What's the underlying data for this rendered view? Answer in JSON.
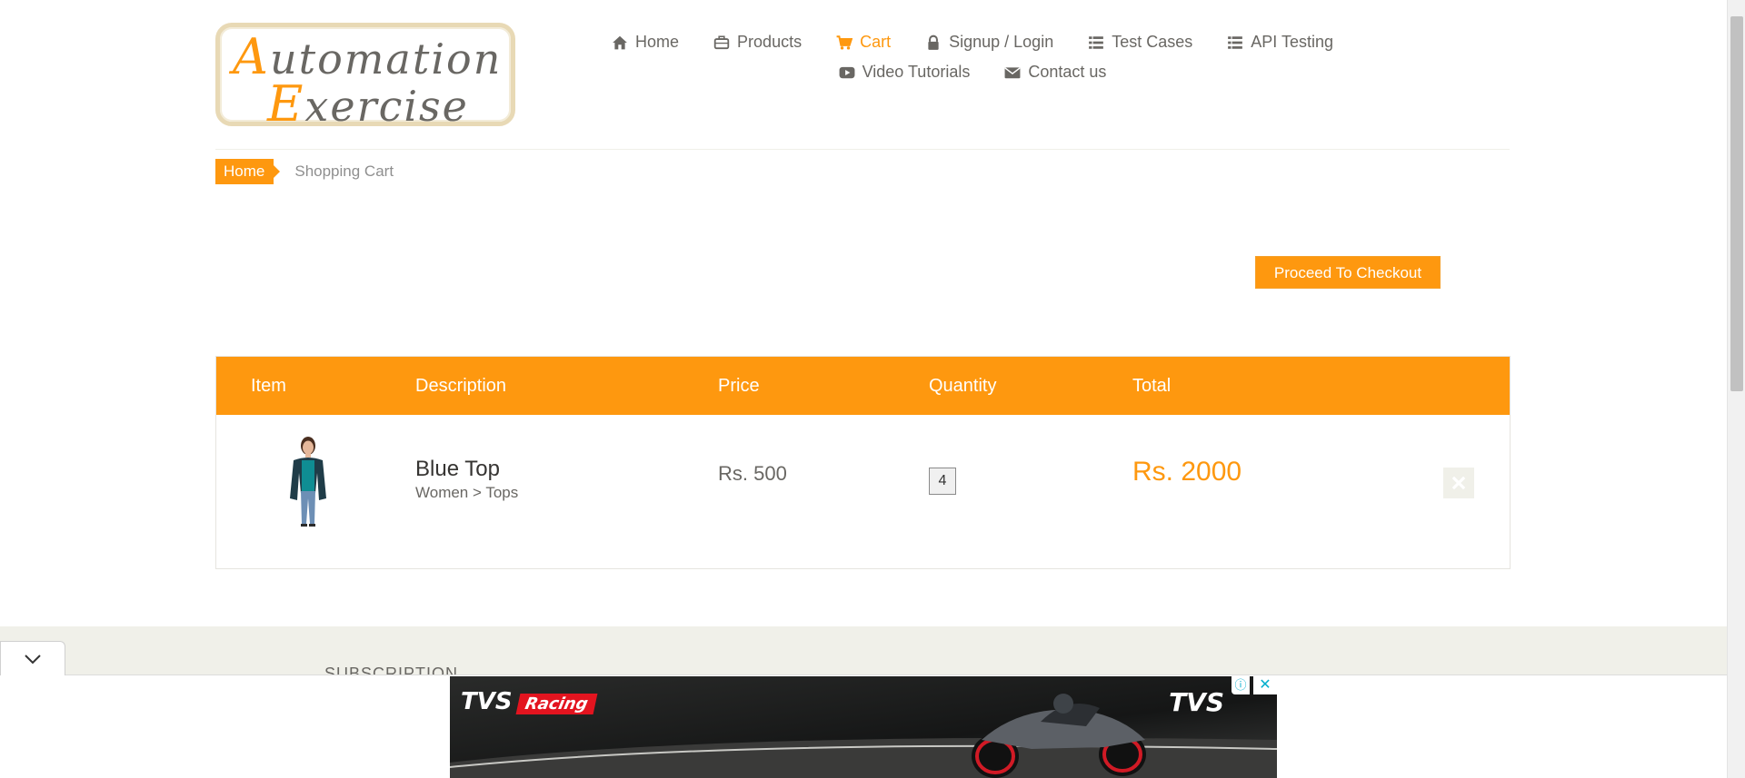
{
  "logo": {
    "line1": "Automation",
    "line2": "Exercise"
  },
  "nav": {
    "items": [
      {
        "label": "Home",
        "icon": "home-icon"
      },
      {
        "label": "Products",
        "icon": "briefcase-icon"
      },
      {
        "label": "Cart",
        "icon": "shopping-cart-icon",
        "active": true
      },
      {
        "label": "Signup / Login",
        "icon": "lock-icon"
      },
      {
        "label": "Test Cases",
        "icon": "list-icon"
      },
      {
        "label": "API Testing",
        "icon": "list-icon"
      },
      {
        "label": "Video Tutorials",
        "icon": "youtube-play-icon"
      },
      {
        "label": "Contact us",
        "icon": "envelope-icon"
      }
    ]
  },
  "breadcrumb": {
    "home": "Home",
    "current": "Shopping Cart"
  },
  "checkout": {
    "label": "Proceed To Checkout"
  },
  "cart": {
    "columns": [
      "Item",
      "Description",
      "Price",
      "Quantity",
      "Total"
    ],
    "rows": [
      {
        "name": "Blue Top",
        "category": "Women > Tops",
        "price": "Rs. 500",
        "quantity": "4",
        "total": "Rs. 2000"
      }
    ]
  },
  "footer": {
    "subscription": "SUBSCRIPTION"
  },
  "ad": {
    "brand_left": "TVS",
    "brand_left_tag": "Racing",
    "brand_right": "TVS",
    "info": "ⓘ",
    "close": "✕"
  },
  "colors": {
    "accent": "#fe980f",
    "text": "#696763",
    "band": "#f0f0e9"
  }
}
